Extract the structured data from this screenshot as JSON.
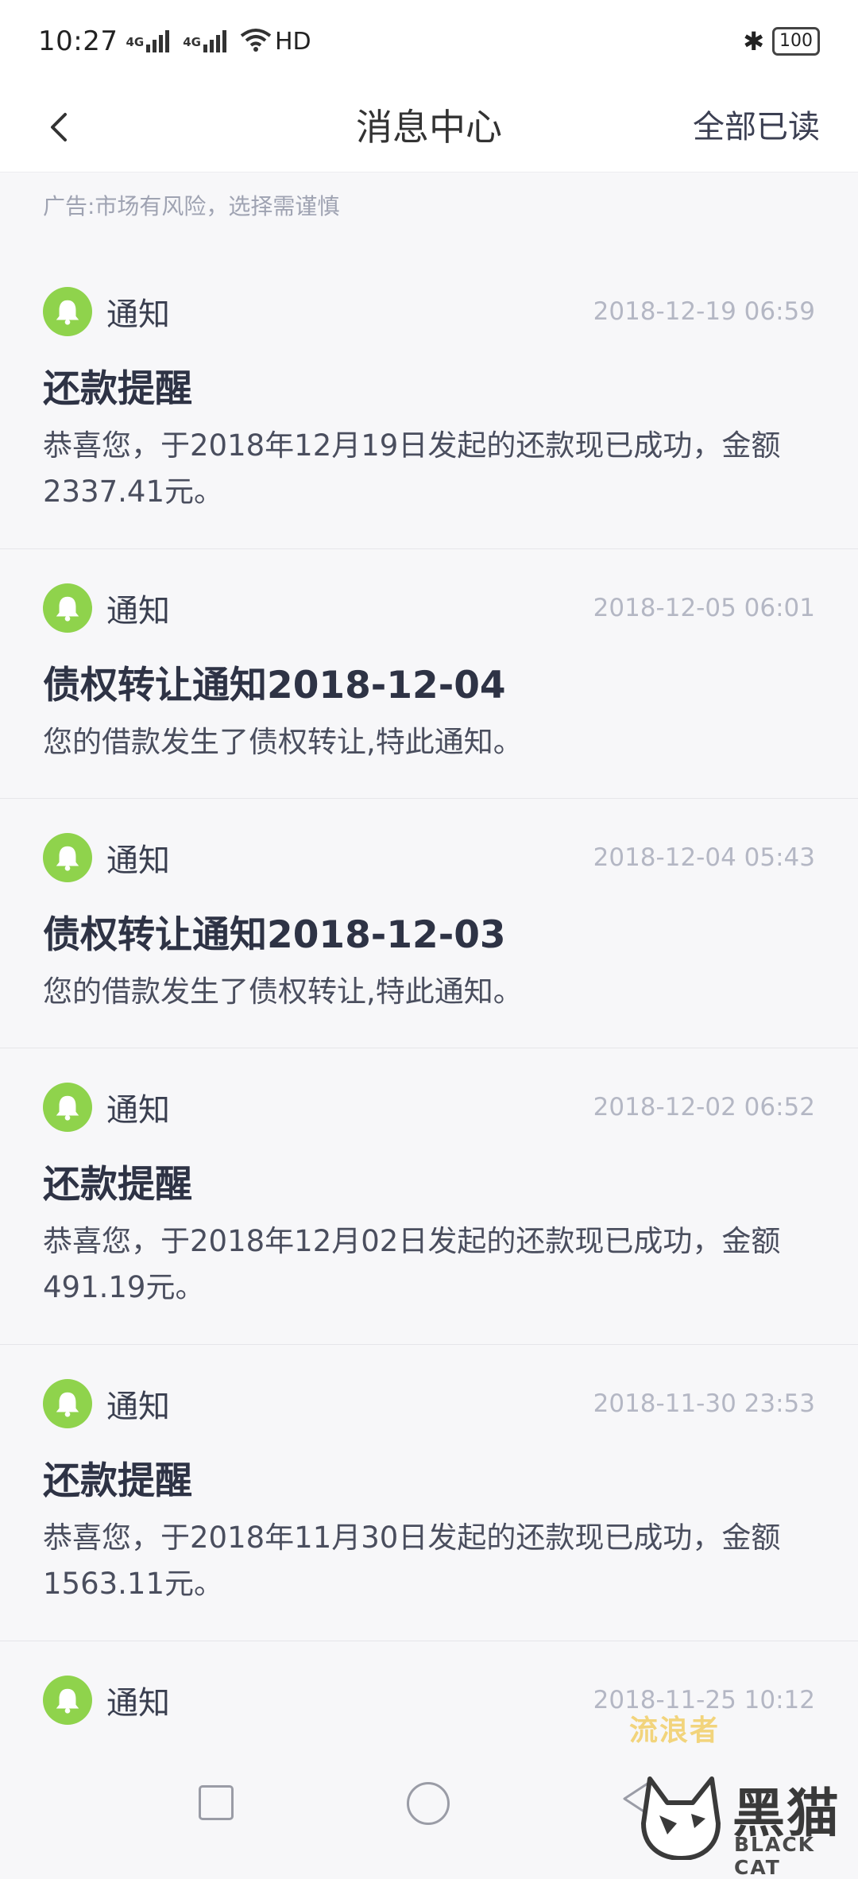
{
  "status_bar": {
    "time": "10:27",
    "sim1": "4G",
    "sim2": "4G",
    "network": "HD",
    "battery": "100"
  },
  "header": {
    "title": "消息中心",
    "mark_all_read": "全部已读",
    "back_icon": "chevron-left-icon"
  },
  "ad": {
    "disclaimer": "广告:市场有风险，选择需谨慎"
  },
  "messages": [
    {
      "type": "通知",
      "time": "2018-12-19 06:59",
      "title": "还款提醒",
      "body": "恭喜您，于2018年12月19日发起的还款现已成功，金额2337.41元。"
    },
    {
      "type": "通知",
      "time": "2018-12-05 06:01",
      "title": "债权转让通知2018-12-04",
      "body": "您的借款发生了债权转让,特此通知。"
    },
    {
      "type": "通知",
      "time": "2018-12-04 05:43",
      "title": "债权转让通知2018-12-03",
      "body": "您的借款发生了债权转让,特此通知。"
    },
    {
      "type": "通知",
      "time": "2018-12-02 06:52",
      "title": "还款提醒",
      "body": "恭喜您，于2018年12月02日发起的还款现已成功，金额491.19元。"
    },
    {
      "type": "通知",
      "time": "2018-11-30 23:53",
      "title": "还款提醒",
      "body": "恭喜您，于2018年11月30日发起的还款现已成功，金额1563.11元。"
    },
    {
      "type": "通知",
      "time": "2018-11-25 10:12",
      "title": "",
      "body": ""
    }
  ],
  "watermark": {
    "text": "流浪者",
    "brand_cn": "黑猫",
    "brand_en": "BLACK CAT"
  },
  "colors": {
    "accent_green": "#8fd34c",
    "background": "#f7f7f9",
    "title_text": "#2e3345",
    "time_text": "#b4b7c4"
  }
}
